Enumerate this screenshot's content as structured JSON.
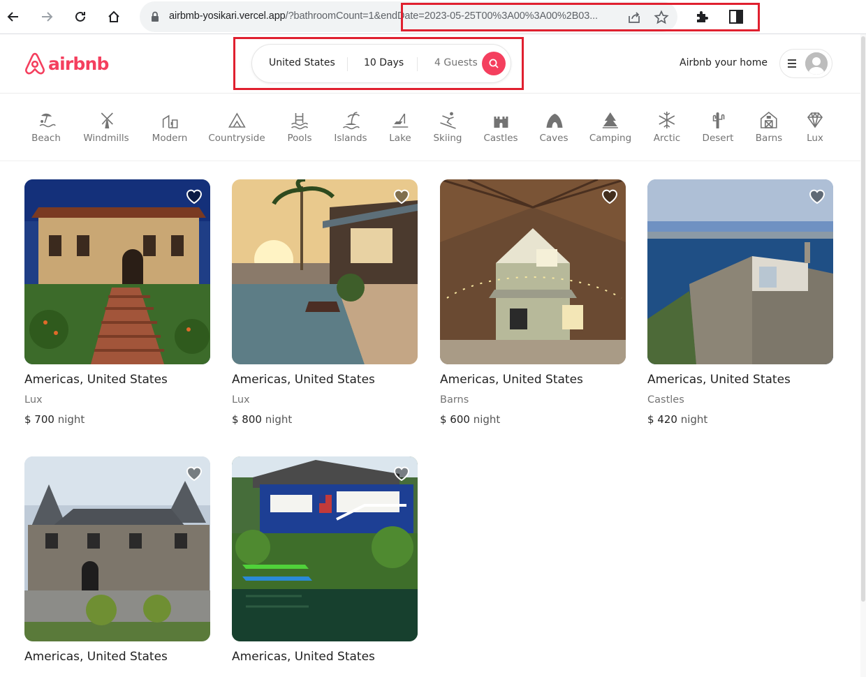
{
  "browser": {
    "url_host": "airbmb-yosikari.vercel.app",
    "url_rest": "/?bathroomCount=1&endDate=2023-05-25T00%3A00%3A00%2B03..."
  },
  "header": {
    "logo_text": "airbnb",
    "search": {
      "location": "United States",
      "duration": "10 Days",
      "guests": "4 Guests"
    },
    "host_link": "Airbnb your home"
  },
  "categories": [
    {
      "label": "Beach",
      "icon": "beach-icon"
    },
    {
      "label": "Windmills",
      "icon": "windmill-icon"
    },
    {
      "label": "Modern",
      "icon": "modern-icon"
    },
    {
      "label": "Countryside",
      "icon": "mountain-icon"
    },
    {
      "label": "Pools",
      "icon": "pool-icon"
    },
    {
      "label": "Islands",
      "icon": "island-icon"
    },
    {
      "label": "Lake",
      "icon": "lake-icon"
    },
    {
      "label": "Skiing",
      "icon": "skiing-icon"
    },
    {
      "label": "Castles",
      "icon": "castle-icon"
    },
    {
      "label": "Caves",
      "icon": "cave-icon"
    },
    {
      "label": "Camping",
      "icon": "camping-icon"
    },
    {
      "label": "Arctic",
      "icon": "snowflake-icon"
    },
    {
      "label": "Desert",
      "icon": "cactus-icon"
    },
    {
      "label": "Barns",
      "icon": "barn-icon"
    },
    {
      "label": "Lux",
      "icon": "diamond-icon"
    }
  ],
  "listings": [
    {
      "location": "Americas, United States",
      "category": "Lux",
      "price": "$ 700",
      "unit": "night"
    },
    {
      "location": "Americas, United States",
      "category": "Lux",
      "price": "$ 800",
      "unit": "night"
    },
    {
      "location": "Americas, United States",
      "category": "Barns",
      "price": "$ 600",
      "unit": "night"
    },
    {
      "location": "Americas, United States",
      "category": "Castles",
      "price": "$ 420",
      "unit": "night"
    },
    {
      "location": "Americas, United States",
      "category": "",
      "price": "",
      "unit": ""
    },
    {
      "location": "Americas, United States",
      "category": "",
      "price": "",
      "unit": ""
    }
  ],
  "colors": {
    "brand": "#F43F5E",
    "highlight": "#e0202f"
  }
}
